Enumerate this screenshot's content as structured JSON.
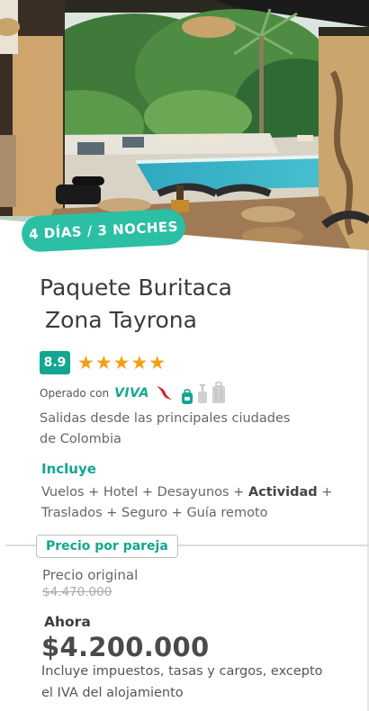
{
  "hero": {
    "image_alt": "Hotel pool with palm trees and dining table",
    "badge": "4 DÍAS / 3 NOCHES"
  },
  "package": {
    "title_line1": "Paquete Buritaca",
    "title_line2": "Zona Tayrona",
    "score": "8.9",
    "stars": "★★★★★",
    "star_count": 5,
    "operated_label": "Operado con",
    "airline": "VIVA",
    "luggage_icons": [
      "backpack-icon",
      "carry-on-icon",
      "checked-bag-icon"
    ],
    "description": "Salidas desde las principales ciudades de Colombia"
  },
  "includes": {
    "heading": "Incluye",
    "part1": "Vuelos + Hotel + Desayunos + ",
    "highlight": "Actividad",
    "part2": " + Traslados + Seguro + Guía remoto"
  },
  "pricing": {
    "tag": "Precio por pareja",
    "original_label": "Precio original",
    "original_value": "$4.470.000",
    "now_label": "Ahora",
    "now_value": "$4.200.000",
    "taxes_note": "Incluye impuestos, tasas y cargos, excepto el IVA del alojamiento"
  },
  "colors": {
    "accent": "#14a68f",
    "badge": "#2bbfa4",
    "stars": "#f2a012",
    "airline_red": "#d3212c"
  }
}
